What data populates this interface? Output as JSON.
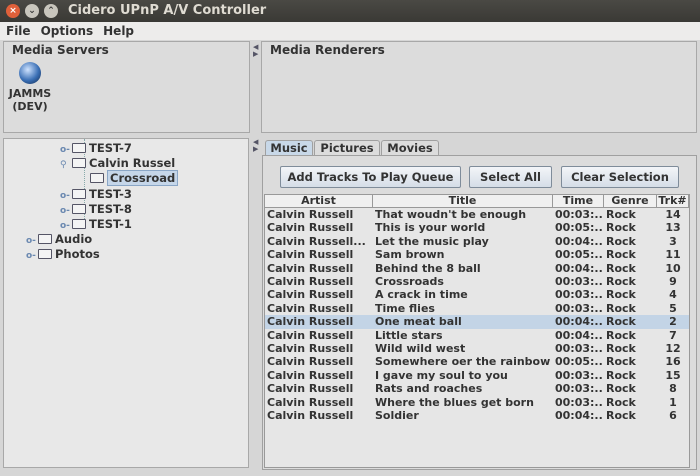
{
  "window": {
    "title": "Cidero UPnP A/V Controller",
    "close": "×",
    "minimize": "⌄",
    "maximize": "⌃"
  },
  "menu": [
    "File",
    "Options",
    "Help"
  ],
  "servers": {
    "title": "Media Servers",
    "items": [
      {
        "name": "JAMMS",
        "sub": "(DEV)",
        "icon": "globe-icon"
      }
    ]
  },
  "renderers": {
    "title": "Media Renderers"
  },
  "tree": [
    {
      "label": "TEST-7",
      "depth": 2,
      "handle": "collapsed"
    },
    {
      "label": "Calvin Russel",
      "depth": 2,
      "handle": "expanded"
    },
    {
      "label": "Crossroad",
      "depth": 3,
      "selected": true
    },
    {
      "label": "TEST-3",
      "depth": 2,
      "handle": "collapsed"
    },
    {
      "label": "TEST-8",
      "depth": 2,
      "handle": "collapsed"
    },
    {
      "label": "TEST-1",
      "depth": 2,
      "handle": "collapsed"
    },
    {
      "label": "Audio",
      "depth": 1,
      "handle": "collapsed"
    },
    {
      "label": "Photos",
      "depth": 1,
      "handle": "collapsed"
    }
  ],
  "tabs": [
    {
      "label": "Music",
      "active": true
    },
    {
      "label": "Pictures"
    },
    {
      "label": "Movies"
    }
  ],
  "buttons": {
    "add": "Add Tracks To Play Queue",
    "select_all": "Select All",
    "clear": "Clear Selection"
  },
  "table": {
    "columns": [
      "Artist",
      "Title",
      "Time",
      "Genre",
      "Trk#"
    ],
    "selected_index": 8,
    "rows": [
      [
        "Calvin Russell",
        "That woudn't be enough",
        "00:03:...",
        "Rock",
        "14"
      ],
      [
        "Calvin Russell",
        "This is your world",
        "00:05:...",
        "Rock",
        "13"
      ],
      [
        "Calvin Russell...",
        "Let the music play",
        "00:04:...",
        "Rock",
        "3"
      ],
      [
        "Calvin Russell",
        "Sam brown",
        "00:05:...",
        "Rock",
        "11"
      ],
      [
        "Calvin Russell",
        "Behind the 8 ball",
        "00:04:...",
        "Rock",
        "10"
      ],
      [
        "Calvin Russell",
        "Crossroads",
        "00:03:...",
        "Rock",
        "9"
      ],
      [
        "Calvin Russell",
        "A crack in time",
        "00:03:...",
        "Rock",
        "4"
      ],
      [
        "Calvin Russell",
        "Time flies",
        "00:03:...",
        "Rock",
        "5"
      ],
      [
        "Calvin Russell",
        "One meat ball",
        "00:04:...",
        "Rock",
        "2"
      ],
      [
        "Calvin Russell",
        "Little stars",
        "00:04:...",
        "Rock",
        "7"
      ],
      [
        "Calvin Russell",
        "Wild wild west",
        "00:03:...",
        "Rock",
        "12"
      ],
      [
        "Calvin Russell",
        "Somewhere oer the rainbow",
        "00:05:...",
        "Rock",
        "16"
      ],
      [
        "Calvin Russell",
        "I gave my soul to you",
        "00:03:...",
        "Rock",
        "15"
      ],
      [
        "Calvin Russell",
        "Rats and roaches",
        "00:03:...",
        "Rock",
        "8"
      ],
      [
        "Calvin Russell",
        "Where the blues get born",
        "00:03:...",
        "Rock",
        "1"
      ],
      [
        "Calvin Russell",
        "Soldier",
        "00:04:...",
        "Rock",
        "6"
      ]
    ]
  }
}
